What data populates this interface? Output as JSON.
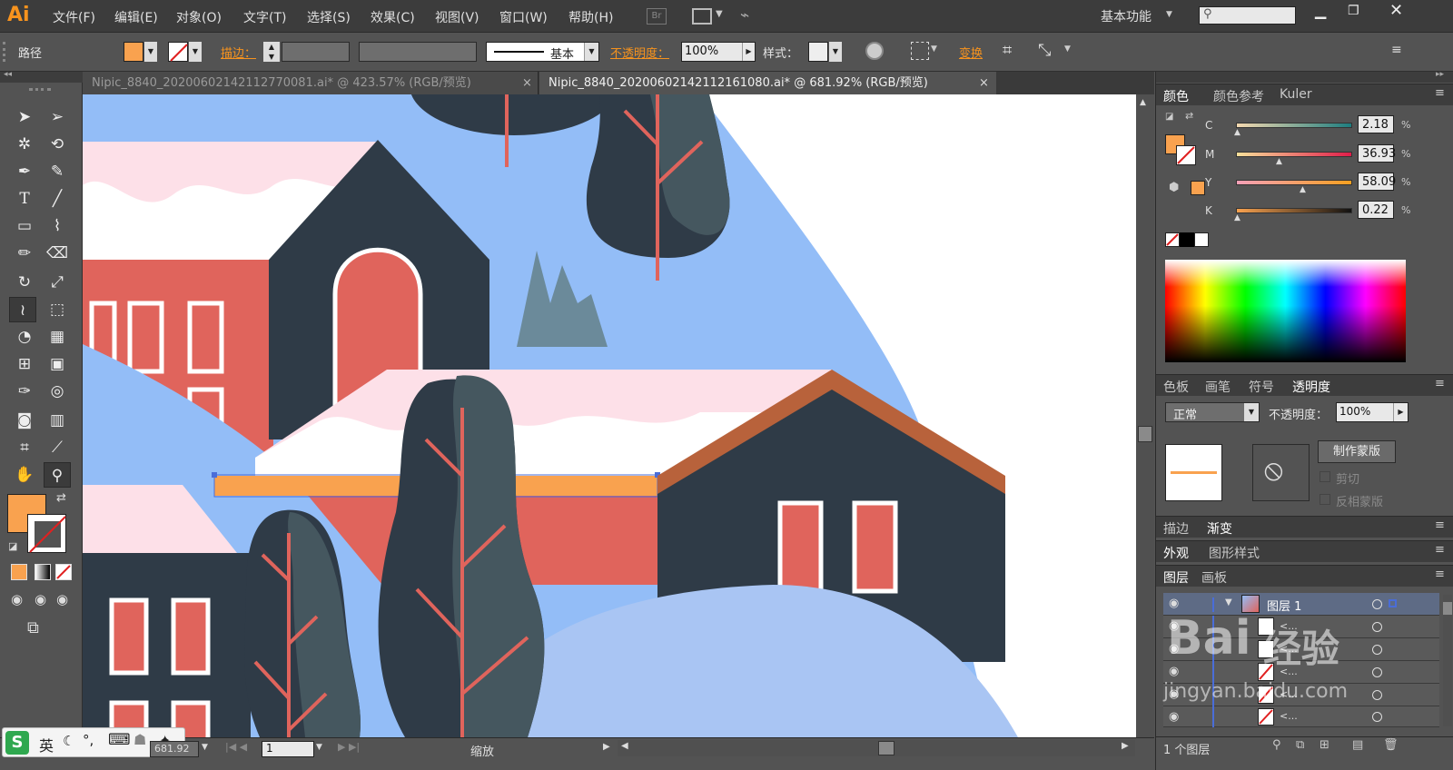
{
  "menu": {
    "logo": "Ai",
    "items": [
      "文件(F)",
      "编辑(E)",
      "对象(O)",
      "文字(T)",
      "选择(S)",
      "效果(C)",
      "视图(V)",
      "窗口(W)",
      "帮助(H)"
    ],
    "br_label": "Br",
    "workspace": "基本功能",
    "search_placeholder": ""
  },
  "control": {
    "selection_label": "路径",
    "stroke_label": "描边：",
    "stroke_profile": "基本",
    "opacity_label": "不透明度：",
    "opacity_value": "100%",
    "style_label": "样式：",
    "transform_label": "变换",
    "fill_color": "#f9a24f"
  },
  "tabs": [
    {
      "label": "Nipic_8840_20200602142112770081.ai* @ 423.57% (RGB/预览)",
      "close": "×"
    },
    {
      "label": "Nipic_8840_20200602142112161080.ai* @ 681.92% (RGB/预览)",
      "close": "×"
    }
  ],
  "status": {
    "zoom_value": "681.92",
    "page_value": "1",
    "zoom_label": "缩放"
  },
  "ime": {
    "label": "英"
  },
  "color_panel": {
    "tabs": [
      "颜色",
      "颜色参考",
      "Kuler"
    ],
    "channels": [
      {
        "name": "C",
        "value": "2.18"
      },
      {
        "name": "M",
        "value": "36.93"
      },
      {
        "name": "Y",
        "value": "58.09"
      },
      {
        "name": "K",
        "value": "0.22"
      }
    ],
    "unit": "%"
  },
  "transparency_panel": {
    "tabs": [
      "色板",
      "画笔",
      "符号",
      "透明度"
    ],
    "blend_mode": "正常",
    "opacity_label": "不透明度：",
    "opacity_value": "100%",
    "make_mask": "制作蒙版",
    "clip": "剪切",
    "invert_mask": "反相蒙版"
  },
  "stroke_gradient_tabs": [
    "描边",
    "渐变"
  ],
  "appearance_tabs": [
    "外观",
    "图形样式"
  ],
  "layers_panel": {
    "tabs": [
      "图层",
      "画板"
    ],
    "layer_name": "图层 1",
    "sublayer_label": "<...",
    "footer": "1 个图层"
  },
  "watermark": {
    "text1": "Bai",
    "text2": "经验",
    "text3": "jingyan.baidu.com"
  },
  "colors": {
    "accent": "#f7931e",
    "fill": "#f9a24f",
    "sky": "#93bdf7",
    "navy": "#2f3b47",
    "red": "#e0645c",
    "pink": "#fde0e8",
    "tree": "#45575f",
    "roof_brown": "#b8623b"
  }
}
